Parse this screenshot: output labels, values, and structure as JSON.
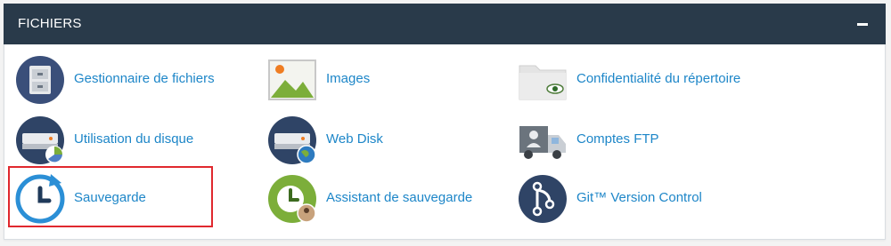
{
  "panel": {
    "title": "FICHIERS",
    "collapse_icon": "minus-icon"
  },
  "colors": {
    "header_bg": "#293a4a",
    "link": "#1d86c8",
    "highlight_border": "#e0282e"
  },
  "items": [
    {
      "label": "Gestionnaire de fichiers",
      "icon": "file-cabinet-icon"
    },
    {
      "label": "Images",
      "icon": "image-icon"
    },
    {
      "label": "Confidentialité du répertoire",
      "icon": "folder-eye-icon"
    },
    {
      "label": "Utilisation du disque",
      "icon": "disk-usage-icon"
    },
    {
      "label": "Web Disk",
      "icon": "web-disk-icon"
    },
    {
      "label": "Comptes FTP",
      "icon": "ftp-truck-icon"
    },
    {
      "label": "Sauvegarde",
      "icon": "backup-clock-icon"
    },
    {
      "label": "Assistant de sauvegarde",
      "icon": "backup-wizard-icon"
    },
    {
      "label": "Git™ Version Control",
      "icon": "git-icon"
    }
  ]
}
